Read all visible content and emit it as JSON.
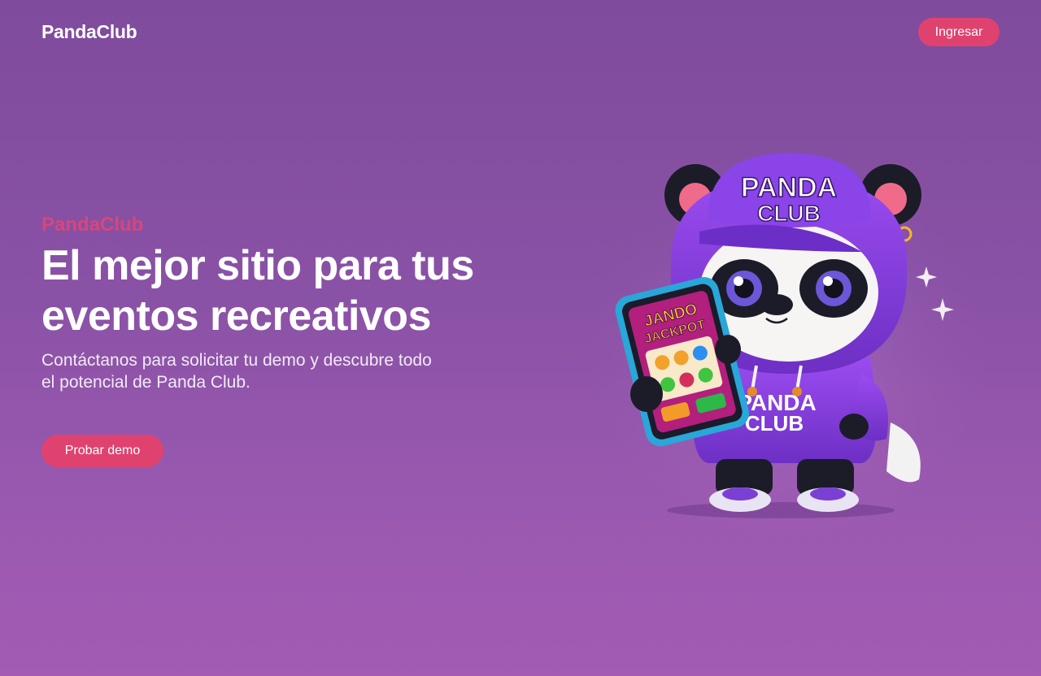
{
  "header": {
    "brand": "PandaClub",
    "login_label": "Ingresar"
  },
  "hero": {
    "eyebrow": "PandaClub",
    "headline_line1": "El mejor sitio para tus",
    "headline_line2": "eventos recreativos",
    "subtext_line1": "Contáctanos para solicitar tu demo y descubre todo",
    "subtext_line2": "el potencial de Panda Club.",
    "demo_label": "Probar demo"
  },
  "illustration": {
    "cap_text_1": "PANDA",
    "cap_text_2": "CLUB",
    "hoodie_text_1": "PANDA",
    "hoodie_text_2": "CLUB",
    "phone_text_1": "JANDO",
    "phone_text_2": "JACKPOT"
  },
  "colors": {
    "accent": "#e0426f",
    "eyebrow": "#d8467a",
    "background_top": "#7f4b9c",
    "background_bottom": "#a35bb3",
    "hoodie": "#8b3fe0"
  }
}
